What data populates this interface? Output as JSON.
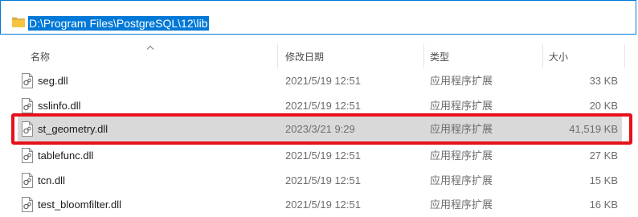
{
  "address_bar": {
    "path": "D:\\Program Files\\PostgreSQL\\12\\lib"
  },
  "columns": {
    "name": "名称",
    "date_modified": "修改日期",
    "type": "类型",
    "size": "大小"
  },
  "files": [
    {
      "name": "seg.dll",
      "date": "2021/5/19 12:51",
      "type": "应用程序扩展",
      "size": "33 KB",
      "selected": false
    },
    {
      "name": "sslinfo.dll",
      "date": "2021/5/19 12:51",
      "type": "应用程序扩展",
      "size": "20 KB",
      "selected": false
    },
    {
      "name": "st_geometry.dll",
      "date": "2023/3/21 9:29",
      "type": "应用程序扩展",
      "size": "41,519 KB",
      "selected": true
    },
    {
      "name": "tablefunc.dll",
      "date": "2021/5/19 12:51",
      "type": "应用程序扩展",
      "size": "27 KB",
      "selected": false
    },
    {
      "name": "tcn.dll",
      "date": "2021/5/19 12:51",
      "type": "应用程序扩展",
      "size": "15 KB",
      "selected": false
    },
    {
      "name": "test_bloomfilter.dll",
      "date": "2021/5/19 12:51",
      "type": "应用程序扩展",
      "size": "16 KB",
      "selected": false
    }
  ],
  "colors": {
    "accent": "#0078d7",
    "selection": "#d9d9d9",
    "highlight_border": "#e8101a"
  },
  "icons": {
    "address_folder": "folder-icon",
    "file": "dll-file-icon"
  }
}
